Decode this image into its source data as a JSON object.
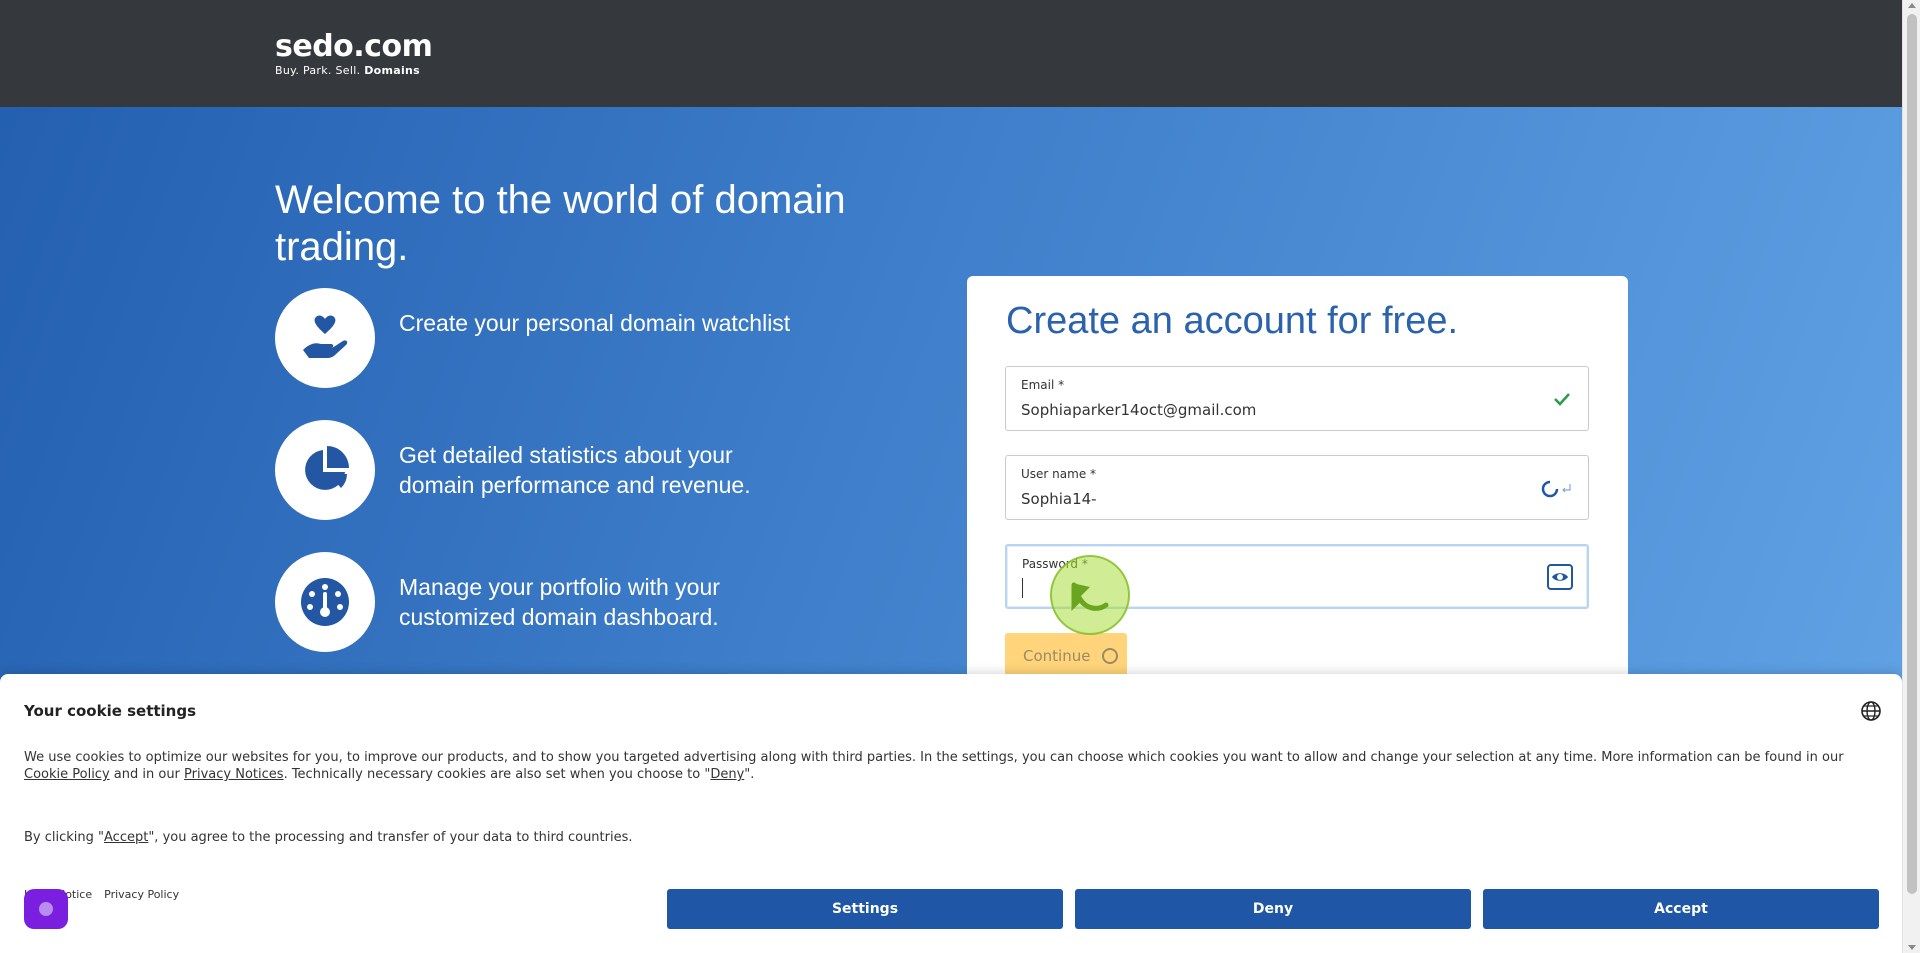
{
  "header": {
    "logo_main": "sedo.com",
    "logo_sub_plain": "Buy.  Park.  Sell.",
    "logo_sub_bold": "Domains"
  },
  "hero": {
    "title": "Welcome to the world of domain trading.",
    "features": [
      {
        "icon": "hand-heart-icon",
        "text": "Create your personal domain watchlist"
      },
      {
        "icon": "pie-chart-icon",
        "text": "Get detailed statistics about your domain performance and revenue."
      },
      {
        "icon": "dashboard-gauge-icon",
        "text": "Manage your portfolio with your customized domain dashboard."
      }
    ]
  },
  "form": {
    "title": "Create an account for free.",
    "email": {
      "label": "Email *",
      "value": "Sophiaparker14oct@gmail.com",
      "status_icon": "checkmark-icon"
    },
    "username": {
      "label": "User name *",
      "value": "Sophia14-",
      "status_icon": "loading-spinner-icon"
    },
    "password": {
      "label": "Password *",
      "value": "",
      "toggle_icon": "eye-icon"
    },
    "continue_label": "Continue"
  },
  "cookie": {
    "title": "Your cookie settings",
    "text_part1": "We use cookies to optimize our websites for you, to improve our products, and to show you targeted advertising along with third parties. In the settings, you can choose which cookies you want to allow and change your selection at any time. More information can be found in our ",
    "cookie_policy_link": "Cookie Policy",
    "text_part2": " and in our ",
    "privacy_notices_link": "Privacy Notices",
    "text_part3": ". Technically necessary cookies are also set when you choose to \"",
    "deny_link": "Deny",
    "text_part4": "\".",
    "accept_text_part1": "By clicking \"",
    "accept_link": "Accept",
    "accept_text_part2": "\", you agree to the processing and transfer of your data to third countries.",
    "link_legal": "Legal Notice",
    "link_privacy": "Privacy Policy",
    "settings_label": "Settings",
    "deny_label": "Deny",
    "accept_label": "Accept"
  },
  "colors": {
    "header_bg": "#35383c",
    "brand_blue": "#1f56a6",
    "title_blue": "#2a62ad",
    "continue_yellow": "#ffd47a",
    "success_green": "#2e9a4a"
  }
}
